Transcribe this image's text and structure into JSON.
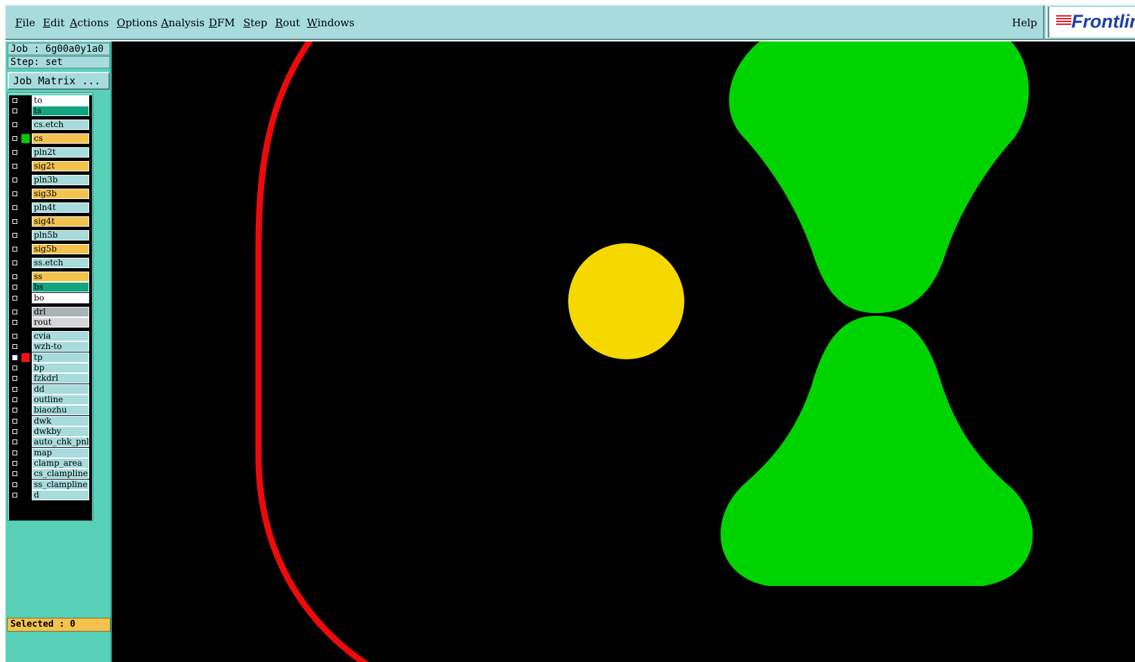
{
  "menubar": {
    "items": [
      "File",
      "Edit",
      "Actions",
      "Options",
      "Analysis",
      "DFM",
      "Step",
      "Rout",
      "Windows"
    ],
    "help": "Help",
    "logo_text": "Frontline"
  },
  "job": {
    "job_line": "Job : 6g00a0y1a0",
    "step_line": "Step: set",
    "job_matrix_label": "Job Matrix ..."
  },
  "layers": [
    {
      "name": "to",
      "color": "#ffffff",
      "swatch": "#000000",
      "checked": false
    },
    {
      "name": "ts",
      "color": "#12a37f",
      "swatch": "#000000",
      "checked": false
    },
    {
      "name": "cs.etch",
      "color": "#a7dbdc",
      "swatch": "#000000",
      "checked": false
    },
    {
      "name": "cs",
      "color": "#f4c24e",
      "swatch": "#00cc00",
      "checked": false
    },
    {
      "name": "pln2t",
      "color": "#a7dbdc",
      "swatch": "#000000",
      "checked": false
    },
    {
      "name": "sig2t",
      "color": "#f4c24e",
      "swatch": "#000000",
      "checked": false
    },
    {
      "name": "pln3b",
      "color": "#a7dbdc",
      "swatch": "#000000",
      "checked": false
    },
    {
      "name": "sig3b",
      "color": "#f4c24e",
      "swatch": "#000000",
      "checked": false
    },
    {
      "name": "pln4t",
      "color": "#a7dbdc",
      "swatch": "#000000",
      "checked": false
    },
    {
      "name": "sig4t",
      "color": "#f4c24e",
      "swatch": "#000000",
      "checked": false
    },
    {
      "name": "pln5b",
      "color": "#a7dbdc",
      "swatch": "#000000",
      "checked": false
    },
    {
      "name": "sig5b",
      "color": "#f4c24e",
      "swatch": "#000000",
      "checked": false
    },
    {
      "name": "ss.etch",
      "color": "#a7dbdc",
      "swatch": "#000000",
      "checked": false
    },
    {
      "name": "ss",
      "color": "#f4c24e",
      "swatch": "#000000",
      "checked": false
    },
    {
      "name": "bs",
      "color": "#12a37f",
      "swatch": "#000000",
      "checked": false
    },
    {
      "name": "bo",
      "color": "#ffffff",
      "swatch": "#000000",
      "checked": false
    },
    {
      "name": "drl",
      "color": "#a9b4b5",
      "swatch": "#000000",
      "checked": false
    },
    {
      "name": "rout",
      "color": "#d6d6d6",
      "swatch": "#000000",
      "checked": false
    },
    {
      "name": "cvia",
      "color": "#a7dbdc",
      "swatch": "#000000",
      "checked": false
    },
    {
      "name": "wzh-to",
      "color": "#a7dbdc",
      "swatch": "#000000",
      "checked": false
    },
    {
      "name": "tp",
      "color": "#a7dbdc",
      "swatch": "#ee1111",
      "checked": true
    },
    {
      "name": "bp",
      "color": "#a7dbdc",
      "swatch": "#000000",
      "checked": false
    },
    {
      "name": "fzkdrl",
      "color": "#a7dbdc",
      "swatch": "#000000",
      "checked": false
    },
    {
      "name": "dd",
      "color": "#a7dbdc",
      "swatch": "#000000",
      "checked": false
    },
    {
      "name": "outline",
      "color": "#a7dbdc",
      "swatch": "#000000",
      "checked": false
    },
    {
      "name": "biaozhu",
      "color": "#a7dbdc",
      "swatch": "#000000",
      "checked": false
    },
    {
      "name": "dwk",
      "color": "#a7dbdc",
      "swatch": "#000000",
      "checked": false
    },
    {
      "name": "dwkby",
      "color": "#a7dbdc",
      "swatch": "#000000",
      "checked": false
    },
    {
      "name": "auto_chk_pnl",
      "color": "#a7dbdc",
      "swatch": "#000000",
      "checked": false
    },
    {
      "name": "map",
      "color": "#a7dbdc",
      "swatch": "#000000",
      "checked": false
    },
    {
      "name": "clamp_area",
      "color": "#a7dbdc",
      "swatch": "#000000",
      "checked": false
    },
    {
      "name": "cs_clampline",
      "color": "#a7dbdc",
      "swatch": "#000000",
      "checked": false
    },
    {
      "name": "ss_clampline",
      "color": "#a7dbdc",
      "swatch": "#000000",
      "checked": false
    },
    {
      "name": "d",
      "color": "#a7dbdc",
      "swatch": "#000000",
      "checked": false
    }
  ],
  "status": {
    "selected": "Selected : 0"
  },
  "colors": {
    "canvas_bg": "#000000",
    "outline_red": "#ee0a0a",
    "pad_green": "#00d400",
    "drill_yellow": "#f5d800"
  }
}
